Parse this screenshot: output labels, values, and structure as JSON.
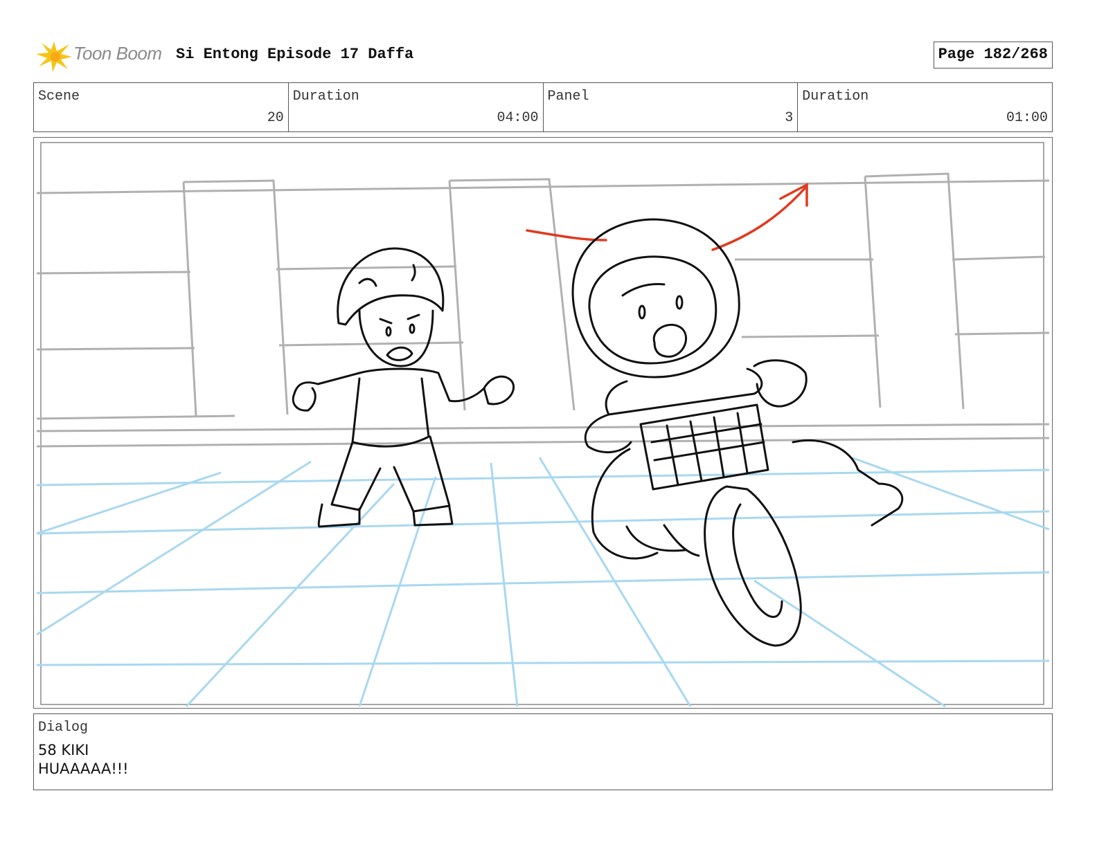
{
  "header": {
    "logo_text": "Toon Boom",
    "title": "Si Entong Episode 17 Daffa",
    "page": "Page 182/268"
  },
  "info": {
    "scene_label": "Scene",
    "scene_value": "20",
    "scene_duration_label": "Duration",
    "scene_duration_value": "04:00",
    "panel_label": "Panel",
    "panel_value": "3",
    "panel_duration_label": "Duration",
    "panel_duration_value": "01:00"
  },
  "dialog": {
    "label": "Dialog",
    "line1": "58 KIKI",
    "line2": "HUAAAAA!!!"
  },
  "colors": {
    "logo_accent": "#f5c518",
    "floor_grid": "#a8d8f0",
    "camera_move_arrow": "#e03a1e",
    "wall_lines": "#b0b0b0",
    "ink": "#111111"
  }
}
